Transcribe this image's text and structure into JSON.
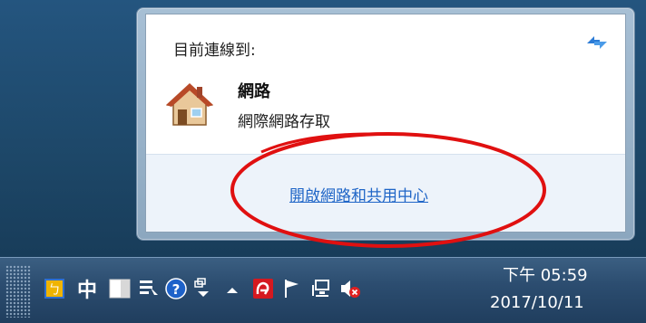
{
  "popup": {
    "connected_title": "目前連線到:",
    "network": {
      "name": "網路",
      "access": "網際網路存取"
    },
    "open_center_link": "開啟網路和共用中心"
  },
  "taskbar": {
    "ime_label": "中",
    "clock": {
      "time": "下午 05:59",
      "date": "2017/10/11"
    }
  },
  "colors": {
    "link": "#2066c7",
    "annotation": "#e01010",
    "taskbar": "#2c4d70"
  },
  "icons": [
    "refresh-icon",
    "house-icon",
    "ime-mode-icon",
    "keyboard-toggle-icon",
    "ime-settings-icon",
    "help-icon",
    "language-bar-icon",
    "show-hidden-icons-icon",
    "avira-icon",
    "action-center-flag-icon",
    "network-icon",
    "volume-muted-icon"
  ]
}
